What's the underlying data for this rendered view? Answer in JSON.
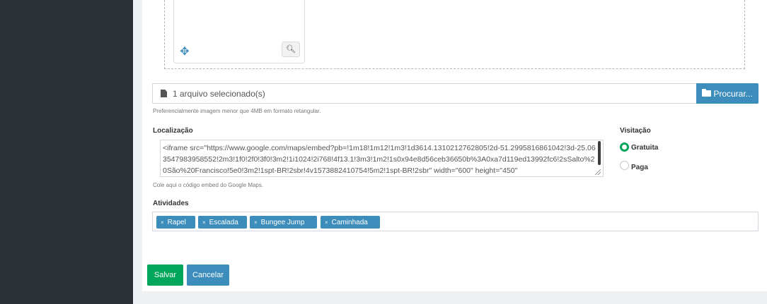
{
  "upload": {
    "file_status": "1 arquivo selecionado(s)",
    "browse_label": "Procurar...",
    "help": "Preferencialmente imagem menor que 4MB em formato retangular."
  },
  "location": {
    "label": "Localização",
    "embed_code": "<iframe src=\"https://www.google.com/maps/embed?pb=!1m18!1m12!1m3!1d3614.1310212762805!2d-51.2995816861042!3d-25.063547983958552!2m3!1f0!2f0!3f0!3m2!1i1024!2i768!4f13.1!3m3!1m2!1s0x94e8d56ceb36650b%3A0xa7d119ed13992fc6!2sSalto%20São%20Francisco!5e0!3m2!1spt-BR!2sbr!4v1573882410754!5m2!1spt-BR!2sbr\" width=\"600\" height=\"450\"",
    "help": "Cole aqui o código embed do Google Maps."
  },
  "visit": {
    "label": "Visitação",
    "options": [
      "Gratuita",
      "Paga"
    ],
    "selected": "Gratuita"
  },
  "activities": {
    "label": "Atividades",
    "tags": [
      "Rapel",
      "Escalada",
      "Bungee Jump",
      "Caminhada"
    ]
  },
  "actions": {
    "save": "Salvar",
    "cancel": "Cancelar"
  },
  "colors": {
    "sidebar": "#2b3036",
    "primary": "#3c8dbc",
    "success": "#00a65a"
  }
}
